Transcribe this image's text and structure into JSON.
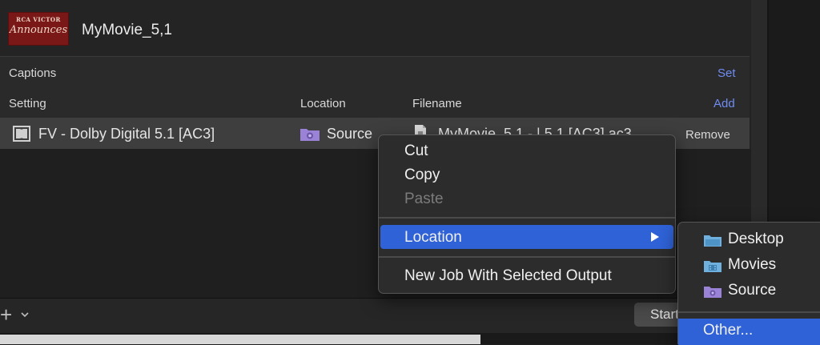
{
  "header": {
    "thumbnail_lines": [
      "RCA VICTOR",
      "Announces"
    ],
    "title": "MyMovie_5,1"
  },
  "captions": {
    "label": "Captions",
    "set_link": "Set"
  },
  "table": {
    "columns": [
      "Setting",
      "Location",
      "Filename"
    ],
    "add_link": "Add",
    "rows": [
      {
        "setting": "FV - Dolby Digital 5.1 [AC3]",
        "location": "Source",
        "filename": "MyMovie_5,1 - | 5.1 [AC3].ac3",
        "action": "Remove"
      }
    ]
  },
  "context_menu": {
    "items": [
      "Cut",
      "Copy",
      "Paste",
      "Location",
      "New Job With Selected Output"
    ],
    "disabled": [
      "Paste"
    ],
    "highlighted": "Location"
  },
  "location_submenu": {
    "items": [
      "Desktop",
      "Movies",
      "Source",
      "Other..."
    ],
    "highlighted": "Other..."
  },
  "bottom_bar": {
    "add_symbol": "+",
    "start_label": "Start"
  },
  "colors": {
    "accent": "#2f62d6",
    "link": "#6f8cf2",
    "folder_blue": "#6fb0de",
    "folder_purple": "#9a82d6"
  }
}
